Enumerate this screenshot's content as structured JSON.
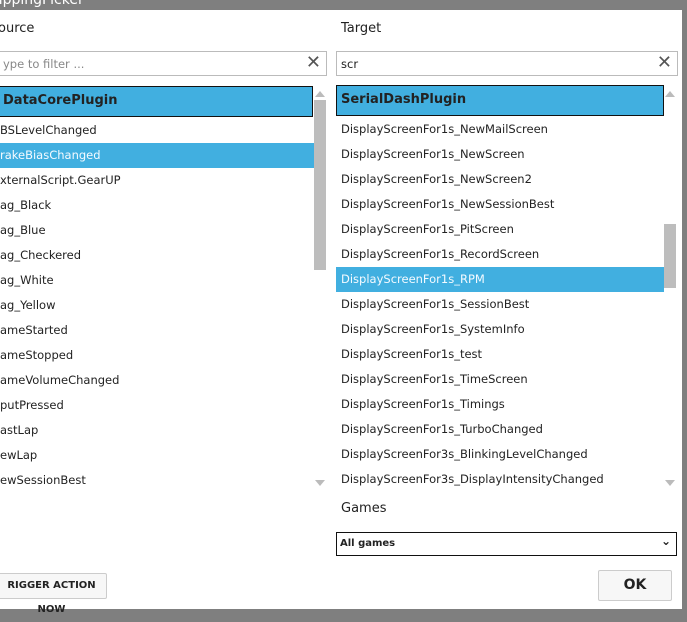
{
  "window": {
    "title": "appingPicker"
  },
  "source": {
    "label": "ource",
    "filter_placeholder": "ype to filter ...",
    "group": "DataCorePlugin",
    "items": [
      "BSLevelChanged",
      "rakeBiasChanged",
      "xternalScript.GearUP",
      "ag_Black",
      "ag_Blue",
      "ag_Checkered",
      "ag_White",
      "ag_Yellow",
      "ameStarted",
      "ameStopped",
      "ameVolumeChanged",
      "putPressed",
      "astLap",
      "ewLap",
      "ewSessionBest"
    ],
    "selected_index": 1
  },
  "target": {
    "label": "Target",
    "filter_value": "scr",
    "group": "SerialDashPlugin",
    "items": [
      "DisplayScreenFor1s_NewMailScreen",
      "DisplayScreenFor1s_NewScreen",
      "DisplayScreenFor1s_NewScreen2",
      "DisplayScreenFor1s_NewSessionBest",
      "DisplayScreenFor1s_PitScreen",
      "DisplayScreenFor1s_RecordScreen",
      "DisplayScreenFor1s_RPM",
      "DisplayScreenFor1s_SessionBest",
      "DisplayScreenFor1s_SystemInfo",
      "DisplayScreenFor1s_test",
      "DisplayScreenFor1s_TimeScreen",
      "DisplayScreenFor1s_Timings",
      "DisplayScreenFor1s_TurboChanged",
      "DisplayScreenFor3s_BlinkingLevelChanged",
      "DisplayScreenFor3s_DisplayIntensityChanged"
    ],
    "selected_index": 6
  },
  "games": {
    "label": "Games",
    "selected": "All games"
  },
  "buttons": {
    "trigger": "RIGGER ACTION NOW",
    "ok": "OK"
  },
  "colors": {
    "accent": "#41afe0"
  }
}
